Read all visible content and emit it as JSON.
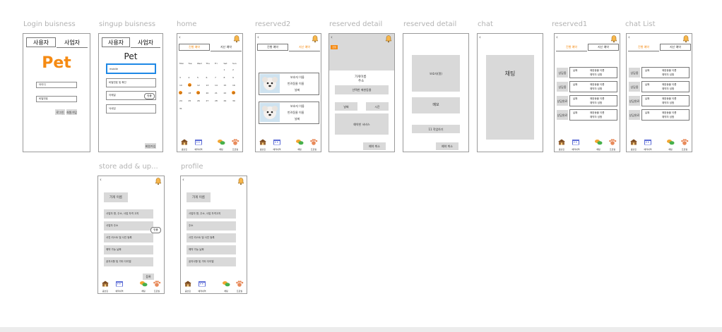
{
  "colors": {
    "accent": "#f58a12",
    "gray_box": "#d9d9d9",
    "border": "#9a9a9a",
    "highlight": "#1e88e5",
    "label": "#b3b3b3"
  },
  "icons": {
    "back": "chevron-left",
    "bell": "bell-icon",
    "store": "store-icon",
    "calendar": "calendar-icon",
    "chat": "chat-bubbles-icon",
    "paw": "paw-icon"
  },
  "nav": {
    "store": "콤브린",
    "reserve": "예약내역",
    "chat": "채팅",
    "profile": "프로필"
  },
  "labels": {
    "login": "Login  buisness",
    "signup": "singup  buisness",
    "home": "home",
    "reserved2": "reserved2",
    "reserved_detail1": "reserved detail",
    "reserved_detail2": "reserved detail",
    "chat": "chat",
    "reserved1": "reserved1",
    "chat_list": "chat List",
    "store_add": "store add & up...",
    "profile": "profile"
  },
  "login": {
    "tab_user": "사용자",
    "tab_biz": "사업자",
    "logo": "Pet",
    "id_placeholder": "아이디",
    "pw_placeholder": "비밀번호",
    "login_btn": "로그인",
    "signup_btn": "회원가입"
  },
  "signup": {
    "tab_user": "사용자",
    "tab_biz": "사업자",
    "title": "Pet",
    "field1": "mobile",
    "field2": "비밀번호 및 확인",
    "field3": "이메일",
    "field3_btn": "인증",
    "field4": "닉네임",
    "submit": "회원가입"
  },
  "home": {
    "tab1": "진행 예약",
    "tab2": "지난 예약",
    "weekdays": [
      "Mon",
      "Tue",
      "Wed",
      "Thu",
      "Fri",
      "Sat",
      "Sun"
    ],
    "days": [
      "1",
      "2",
      "3",
      "4",
      "5",
      "6",
      "7",
      "8",
      "9",
      "10",
      "11",
      "12",
      "13",
      "14",
      "15",
      "16",
      "17",
      "18",
      "19",
      "20",
      "21",
      "22",
      "23",
      "24",
      "25",
      "26",
      "27",
      "28",
      "29",
      "30",
      "31"
    ]
  },
  "reserved2": {
    "tab1": "진행 예약",
    "tab2": "지난 예약",
    "cards": [
      {
        "guardian": "보호자 이름",
        "pet": "반려동물 이름",
        "date": "날짜"
      },
      {
        "guardian": "보호자 이름",
        "pet": "반려동물 이름",
        "date": "날짜"
      }
    ]
  },
  "rdetail1": {
    "badge": "진행",
    "store_name": "가게이름",
    "address": "주소",
    "pet_btn": "선택한 애완동물",
    "date_btn": "날짜",
    "time_btn": "시간",
    "service_btn": "예약한 서비스",
    "cancel_btn": "예약 취소"
  },
  "rdetail2": {
    "box1": "보호자(명)",
    "box2": "메모",
    "box3": "11 작업하기",
    "cancel_btn": "예약 취소"
  },
  "chat": {
    "title": "채팅"
  },
  "reserved1": {
    "tab1": "진행 예약",
    "tab2": "지난 예약",
    "rows": [
      {
        "status": "상담중",
        "date": "날짜",
        "pet": "애완동물 이름",
        "note": "예약자 성함"
      },
      {
        "status": "상담중",
        "date": "날짜",
        "pet": "애완동물 이름",
        "note": "예약자 성함"
      },
      {
        "status": "상담완료",
        "date": "날짜",
        "pet": "애완동물 이름",
        "note": "예약자 성함"
      },
      {
        "status": "상담완료",
        "date": "날짜",
        "pet": "애완동물 이름",
        "note": "예약자 성함"
      }
    ]
  },
  "chatlist": {
    "tab1": "진행 예약",
    "tab2": "지난 예약",
    "rows": [
      {
        "status": "상담중",
        "date": "날짜",
        "pet": "애완동물 이름",
        "note": "예약자 성함"
      },
      {
        "status": "상담중",
        "date": "날짜",
        "pet": "애완동물 이름",
        "note": "예약자 성함"
      },
      {
        "status": "상담완료",
        "date": "날짜",
        "pet": "애완동물 이름",
        "note": "예약자 성함"
      },
      {
        "status": "상담완료",
        "date": "날짜",
        "pet": "애완동물 이름",
        "note": "예약자 성함"
      }
    ]
  },
  "store": {
    "name_btn": "가게 이름",
    "rows": [
      "사업자 명, 주소, 사업 자격 고지",
      "사업자 주소",
      "사진 리스트 및 사진 등록",
      "예약 가능 날짜",
      "공지사항 및 기타 다이얼"
    ],
    "verify": "인증",
    "register": "등록"
  },
  "profile": {
    "name_btn": "가게 이름",
    "rows": [
      "사업자 명, 주소, 사업 자격고지",
      "주소",
      "사진 리스트 및 사진 등록",
      "예약 가능 날짜",
      "공지사항 및 기타 다이얼"
    ]
  }
}
